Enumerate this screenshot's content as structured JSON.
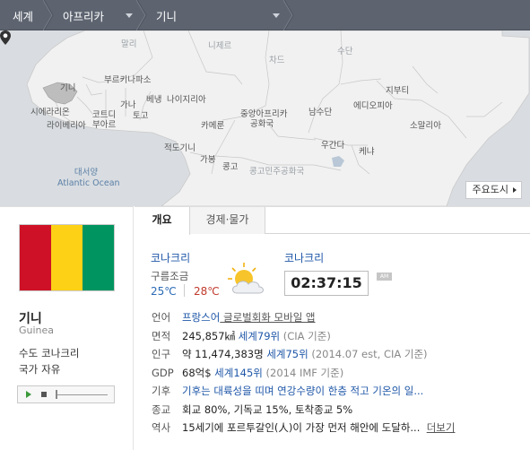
{
  "breadcrumb": {
    "items": [
      "세계",
      "아프리카",
      "기니"
    ]
  },
  "map": {
    "labels": {
      "mali": "말리",
      "niger": "니제르",
      "chad": "차드",
      "sudan": "수단",
      "guinea": "기니",
      "burkina": "부르키나파소",
      "ghana": "가나",
      "togo": "토고",
      "benin": "베냉",
      "nigeria": "나이지리아",
      "djibouti": "지부티",
      "sierra": "시에라리온",
      "liberia": "라이베리아",
      "ivory1": "코트디",
      "ivory2": "부아르",
      "car1": "중앙아프리카",
      "car2": "공화국",
      "southsudan": "남수단",
      "ethiopia": "에디오피아",
      "somalia": "소말리아",
      "cameroon": "카메룬",
      "eqguinea": "적도기니",
      "uganda": "우간다",
      "kenya": "케냐",
      "gabon": "가봉",
      "congo": "콩고",
      "drc": "콩고민주공화국",
      "ocean_ko": "대서양",
      "ocean_en": "Atlantic Ocean"
    },
    "cities_button": "주요도시"
  },
  "country": {
    "name": "기니",
    "name_en": "Guinea",
    "capital_label": "수도",
    "capital": "코나크리",
    "anthem_label": "국가",
    "anthem": "자유",
    "flag_colors": [
      "#ce1126",
      "#fcd116",
      "#009460"
    ]
  },
  "tabs": [
    "개요",
    "경제·물가"
  ],
  "weather": {
    "city": "코나크리",
    "condition": "구름조금",
    "low": "25℃",
    "high": "28℃",
    "icon": "partly-cloudy-icon"
  },
  "clock": {
    "city": "코나크리",
    "time": "02:37:15",
    "ampm": "AM"
  },
  "overview": [
    {
      "key": "언어",
      "parts": [
        {
          "t": "프랑스어",
          "s": "link"
        },
        {
          "t": " 글로벌회화 모바일 앱",
          "s": "ul"
        }
      ]
    },
    {
      "key": "면적",
      "parts": [
        {
          "t": "245,857㎢",
          "s": "v1"
        },
        {
          "t": " 세계79위",
          "s": "link"
        },
        {
          "t": " (CIA 기준)",
          "s": "gray"
        }
      ]
    },
    {
      "key": "인구",
      "parts": [
        {
          "t": "약 11,474,383명",
          "s": "v1"
        },
        {
          "t": " 세계75위",
          "s": "link"
        },
        {
          "t": " (2014.07 est, CIA 기준)",
          "s": "gray"
        }
      ]
    },
    {
      "key": "GDP",
      "parts": [
        {
          "t": "68억$",
          "s": "v1"
        },
        {
          "t": " 세계145위",
          "s": "link"
        },
        {
          "t": " (2014 IMF 기준)",
          "s": "gray"
        }
      ]
    },
    {
      "key": "기후",
      "parts": [
        {
          "t": "기후는 대륙성을 띠며 연강수량이 한층 적고 기온의 일...",
          "s": "link"
        }
      ]
    },
    {
      "key": "종교",
      "parts": [
        {
          "t": "회교 80%, 기독교 15%, 토착종교 5%",
          "s": "v1"
        }
      ]
    },
    {
      "key": "역사",
      "parts": [
        {
          "t": "15세기에 포르투갈인(人)이 가장 먼저 해안에 도달하...",
          "s": "v1"
        },
        {
          "t": "  ",
          "s": "v1"
        },
        {
          "t": "더보기",
          "s": "ul"
        }
      ]
    }
  ]
}
